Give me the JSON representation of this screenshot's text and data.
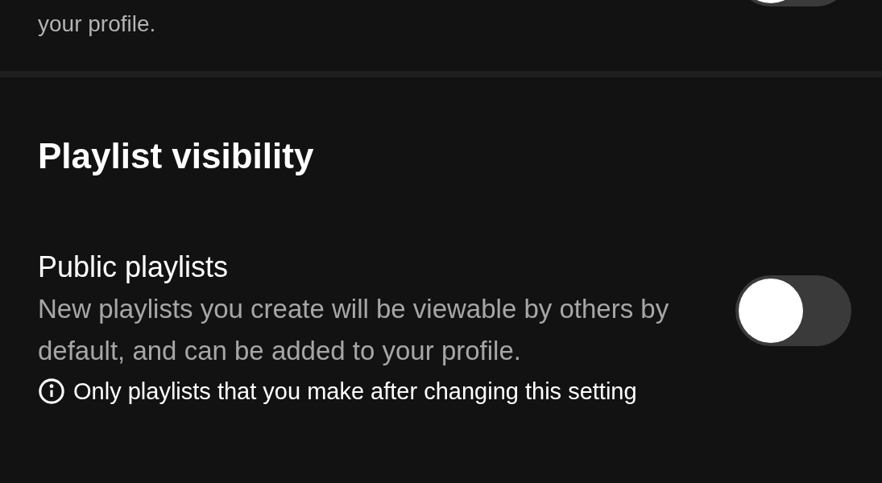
{
  "previous_setting": {
    "description_end": "your profile.",
    "on": false
  },
  "section": {
    "title": "Playlist visibility",
    "settings": [
      {
        "label": "Public playlists",
        "description": "New playlists you create will be viewable by others by default, and can be added to your profile.",
        "on": false
      }
    ],
    "note": "Only playlists that you make after changing this setting"
  }
}
